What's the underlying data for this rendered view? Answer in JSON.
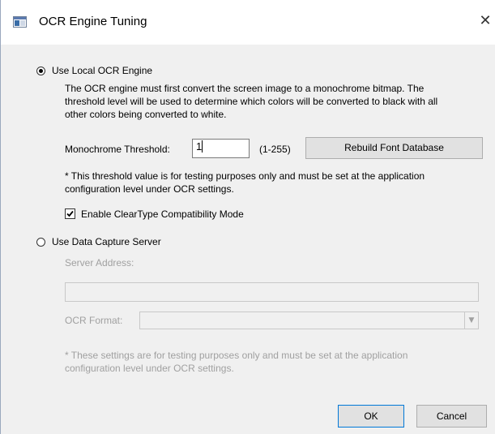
{
  "window": {
    "title": "OCR Engine Tuning",
    "close_glyph": "✕"
  },
  "local_engine": {
    "radio_label": "Use Local OCR Engine",
    "selected": true,
    "description": "The OCR engine must first convert the screen image to a monochrome bitmap.  The\nthreshold level will be used to determine which colors will be converted to black with all\nother colors being converted to white.",
    "threshold_label": "Monochrome Threshold:",
    "threshold_value": "1",
    "threshold_range": "(1-255)",
    "rebuild_button": "Rebuild Font Database",
    "threshold_note": "* This threshold value is for testing purposes only and must be set at the application\nconfiguration level under OCR settings.",
    "cleartype_label": "Enable ClearType Compatibility Mode",
    "cleartype_checked": true
  },
  "data_capture": {
    "radio_label": "Use Data Capture Server",
    "selected": false,
    "server_address_label": "Server Address:",
    "server_address_value": "",
    "ocr_format_label": "OCR Format:",
    "ocr_format_value": "",
    "note": "* These settings are for testing purposes only and must be set at the application\nconfiguration level under OCR settings."
  },
  "footer": {
    "ok_label": "OK",
    "cancel_label": "Cancel"
  },
  "icons": {
    "app": "window-app-icon",
    "close": "close-icon",
    "check": "check-icon",
    "dropdown": "chevron-down-icon"
  },
  "colors": {
    "dialog_bg": "#f0f0f0",
    "disabled_text": "#a0a0a0",
    "default_button_border": "#0078d7"
  }
}
